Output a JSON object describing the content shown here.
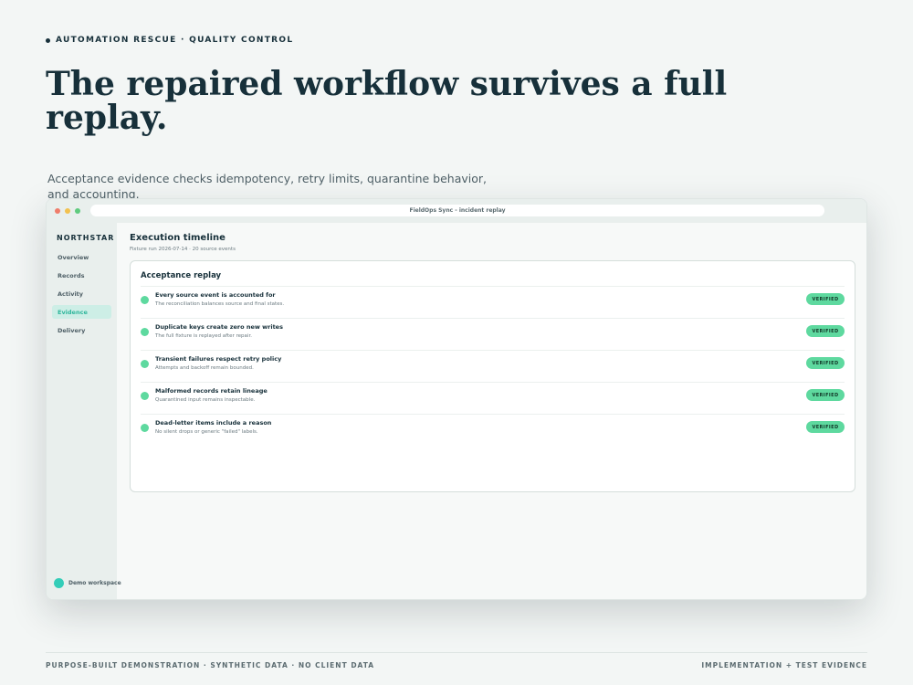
{
  "page": {
    "eyebrow": "AUTOMATION RESCUE · QUALITY CONTROL",
    "headline": "The repaired workflow survives a full replay.",
    "lede": "Acceptance evidence checks idempotency, retry limits, quarantine behavior, and accounting."
  },
  "window": {
    "url_title": "FieldOps Sync - incident replay"
  },
  "sidebar": {
    "brand": "NORTHSTAR",
    "items": [
      {
        "label": "Overview",
        "active": false
      },
      {
        "label": "Records",
        "active": false
      },
      {
        "label": "Activity",
        "active": false
      },
      {
        "label": "Evidence",
        "active": true
      },
      {
        "label": "Delivery",
        "active": false
      }
    ],
    "workspace": "Demo workspace"
  },
  "main": {
    "title": "Execution timeline",
    "subtitle": "Fixture run 2026-07-14 · 20 source events",
    "card": {
      "title": "Acceptance replay",
      "rows": [
        {
          "title": "Every source event is accounted for",
          "desc": "The reconciliation balances source and final states.",
          "badge": "VERIFIED"
        },
        {
          "title": "Duplicate keys create zero new writes",
          "desc": "The full fixture is replayed after repair.",
          "badge": "VERIFIED"
        },
        {
          "title": "Transient failures respect retry policy",
          "desc": "Attempts and backoff remain bounded.",
          "badge": "VERIFIED"
        },
        {
          "title": "Malformed records retain lineage",
          "desc": "Quarantined input remains inspectable.",
          "badge": "VERIFIED"
        },
        {
          "title": "Dead-letter items include a reason",
          "desc": "No silent drops or generic \"failed\" labels.",
          "badge": "VERIFIED"
        }
      ]
    }
  },
  "footer": {
    "left": "PURPOSE-BUILT DEMONSTRATION · SYNTHETIC DATA · NO CLIENT DATA",
    "right": "IMPLEMENTATION + TEST EVIDENCE"
  },
  "colors": {
    "accent": "#2fb79c",
    "status_ok": "#5ed99f",
    "ink": "#17303a"
  }
}
